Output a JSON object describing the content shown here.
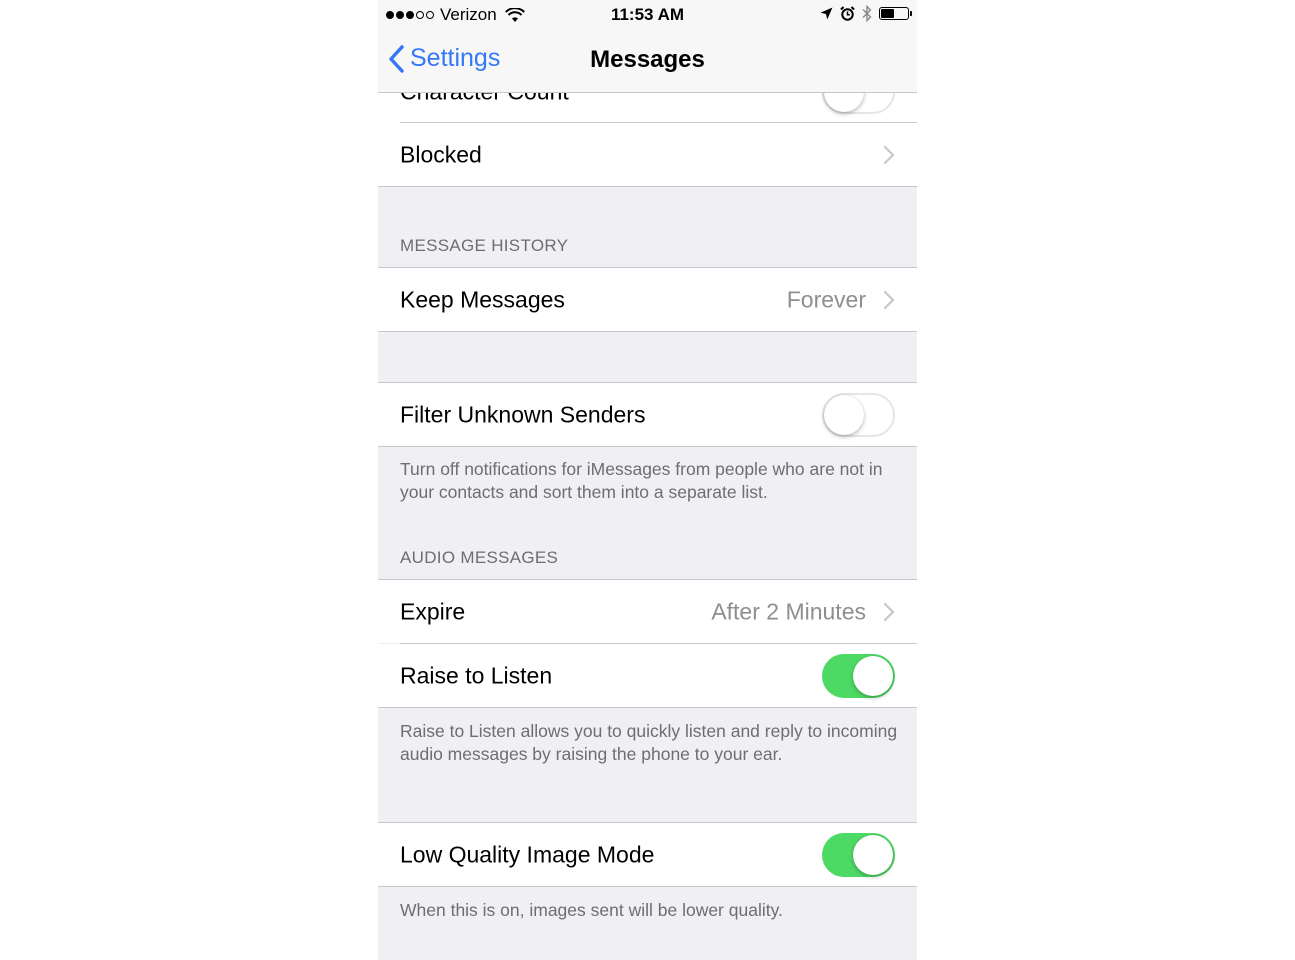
{
  "status_bar": {
    "carrier": "Verizon",
    "time": "11:53 AM",
    "signal_bars_filled": 3,
    "signal_bars_total": 5,
    "battery_level": 0.45
  },
  "nav": {
    "back_label": "Settings",
    "title": "Messages"
  },
  "rows": {
    "character_count": {
      "label": "Character Count",
      "toggle_on": false
    },
    "blocked": {
      "label": "Blocked"
    },
    "keep_messages": {
      "label": "Keep Messages",
      "value": "Forever"
    },
    "filter_unknown": {
      "label": "Filter Unknown Senders",
      "toggle_on": false
    },
    "expire": {
      "label": "Expire",
      "value": "After 2 Minutes"
    },
    "raise_to_listen": {
      "label": "Raise to Listen",
      "toggle_on": true
    },
    "low_quality": {
      "label": "Low Quality Image Mode",
      "toggle_on": true
    }
  },
  "sections": {
    "message_history": "MESSAGE HISTORY",
    "audio_messages": "AUDIO MESSAGES"
  },
  "footers": {
    "filter_unknown": "Turn off notifications for iMessages from people who are not in your contacts and sort them into a separate list.",
    "raise_to_listen": "Raise to Listen allows you to quickly listen and reply to incoming audio messages by raising the phone to your ear.",
    "low_quality": "When this is on, images sent will be lower quality."
  },
  "colors": {
    "accent": "#3478f6",
    "toggle_on": "#4cd964",
    "group_background": "#efeff4",
    "secondary_text": "#8e8e93",
    "footer_text": "#6d6d72"
  },
  "icons": [
    "wifi-icon",
    "location-arrow-icon",
    "alarm-icon",
    "bluetooth-icon",
    "battery-icon",
    "back-chevron-icon",
    "disclosure-chevron-icon"
  ]
}
